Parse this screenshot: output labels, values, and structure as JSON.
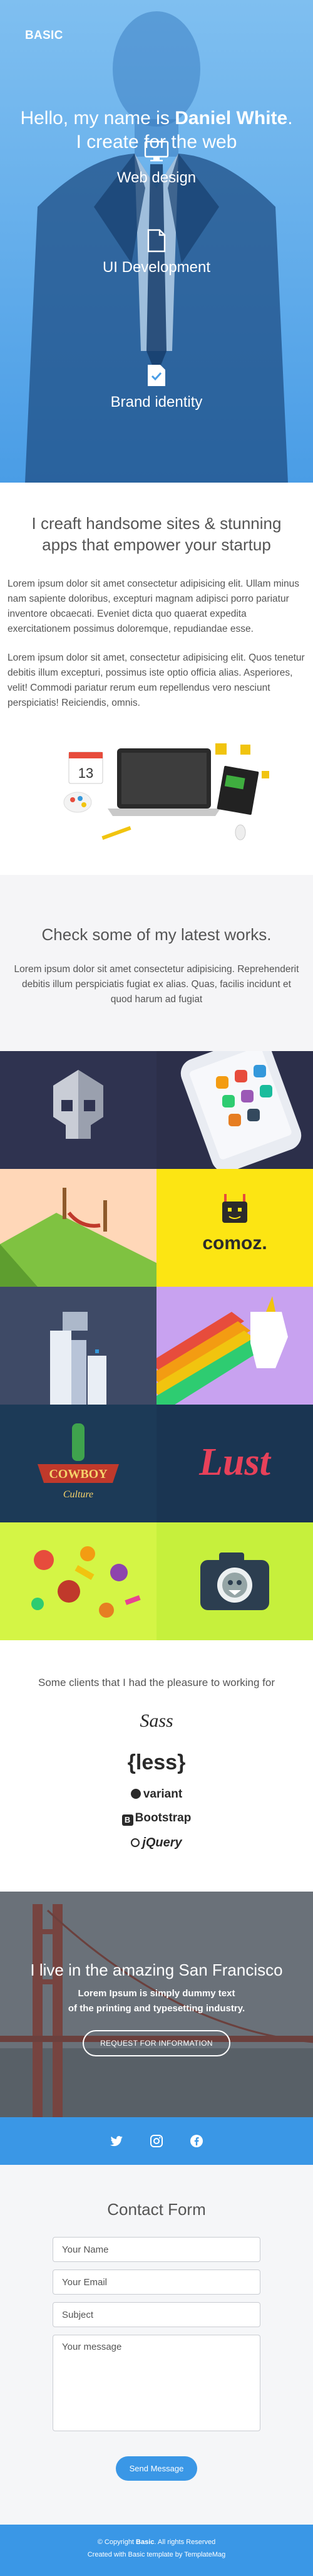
{
  "brand": "BASIC",
  "hero": {
    "greeting_prefix": "Hello, my name is ",
    "name": "Daniel White",
    "greeting_suffix": ".",
    "tagline": "I create for the web",
    "services": [
      {
        "label": "Web design",
        "icon": "monitor-icon"
      },
      {
        "label": "UI Development",
        "icon": "document-icon"
      },
      {
        "label": "Brand identity",
        "icon": "checklist-icon"
      }
    ],
    "accent": "#4098e8"
  },
  "intro": {
    "heading": "I creaft handsome sites & stunning apps that empower your startup",
    "paragraphs": [
      "Lorem ipsum dolor sit amet consectetur adipisicing elit. Ullam minus nam sapiente doloribus, excepturi magnam adipisci porro pariatur inventore obcaecati. Eveniet dicta quo quaerat expedita exercitationem possimus doloremque, repudiandae esse.",
      "Lorem ipsum dolor sit amet, consectetur adipisicing elit. Quos tenetur debitis illum excepturi, possimus iste optio officia alias. Asperiores, velit! Commodi pariatur rerum eum repellendus vero nesciunt perspiciatis! Reiciendis, omnis."
    ],
    "calendar_day": "13"
  },
  "works": {
    "heading": "Check some of my latest works.",
    "text": "Lorem ipsum dolor sit amet consectetur adipisicing. Reprehenderit debitis illum perspiciatis fugiat ex alias. Quas, facilis incidunt et quod harum ad fugiat",
    "tiles": [
      {
        "name": "skull",
        "bg": "#2f3350"
      },
      {
        "name": "phone-apps",
        "bg": "#2c2f4a"
      },
      {
        "name": "island-hammock",
        "bg": "#ffd7b8"
      },
      {
        "name": "comoz",
        "bg": "#fce513",
        "label": "comoz."
      },
      {
        "name": "city-towers",
        "bg": "#3e4a66"
      },
      {
        "name": "unicorn-rainbow",
        "bg": "#c8a2f0"
      },
      {
        "name": "cowboy-culture",
        "bg": "#1c3a57",
        "label_top": "COWBOY",
        "label_bottom": "Culture"
      },
      {
        "name": "lust-lettering",
        "bg": "#1a3552",
        "label": "Lust"
      },
      {
        "name": "food-scatter",
        "bg": "#d4f545"
      },
      {
        "name": "camera-monster",
        "bg": "#c6f03c"
      }
    ]
  },
  "clients": {
    "heading": "Some clients that I had the pleasure to working for",
    "logos": [
      "Sass",
      "{less}",
      "variant",
      "Bootstrap",
      "jQuery"
    ]
  },
  "sf": {
    "heading": "I live in the amazing San Francisco",
    "text_line1": "Lorem Ipsum is simply dummy text",
    "text_line2": "of the printing and typesetting industry.",
    "button": "REQUEST FOR INFORMATION"
  },
  "social": [
    "twitter-icon",
    "instagram-icon",
    "facebook-icon"
  ],
  "contact": {
    "heading": "Contact Form",
    "name_placeholder": "Your Name",
    "email_placeholder": "Your Email",
    "subject_placeholder": "Subject",
    "message_placeholder": "Your message",
    "send": "Send Message"
  },
  "footer": {
    "copyright_prefix": "© Copyright ",
    "copyright_brand": "Basic",
    "copyright_suffix": ". All rights Reserved",
    "credit_prefix": "Created with Basic template by ",
    "credit_author": "TemplateMag"
  }
}
